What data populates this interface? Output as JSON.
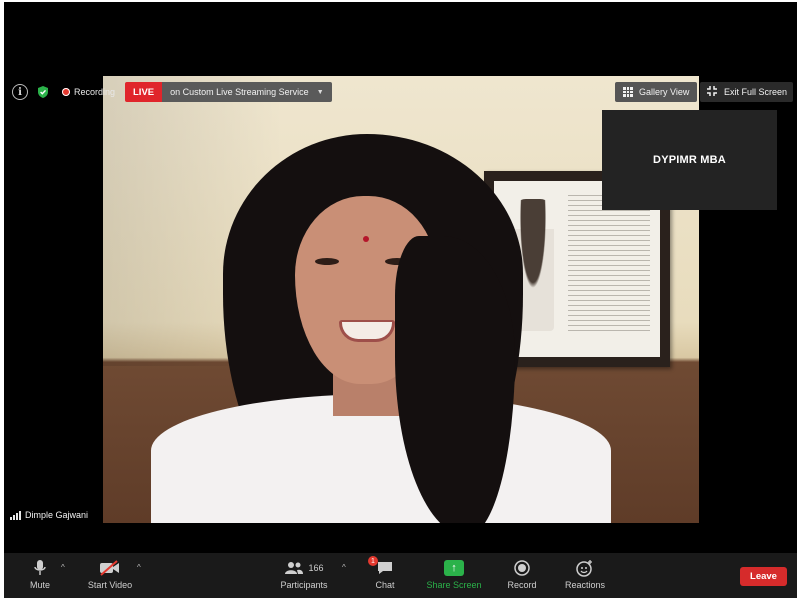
{
  "status": {
    "recording_label": "Recording",
    "live_label": "LIVE",
    "stream_service": "on Custom Live Streaming Service"
  },
  "view": {
    "gallery_label": "Gallery View",
    "exit_fullscreen_label": "Exit Full Screen"
  },
  "participants_panel": {
    "tile_name": "DYPIMR MBA",
    "speaker_name": "Dimple Gajwani"
  },
  "toolbar": {
    "mute_label": "Mute",
    "video_label": "Start Video",
    "participants_count": "166",
    "participants_label": "Participants",
    "chat_label": "Chat",
    "chat_badge": "1",
    "share_label": "Share Screen",
    "record_label": "Record",
    "reactions_label": "Reactions",
    "leave_label": "Leave"
  },
  "colors": {
    "live_red": "#e0252b",
    "share_green": "#2bb24a",
    "leave_red": "#d62b2b",
    "toolbar_bg": "#1a1a1a"
  }
}
